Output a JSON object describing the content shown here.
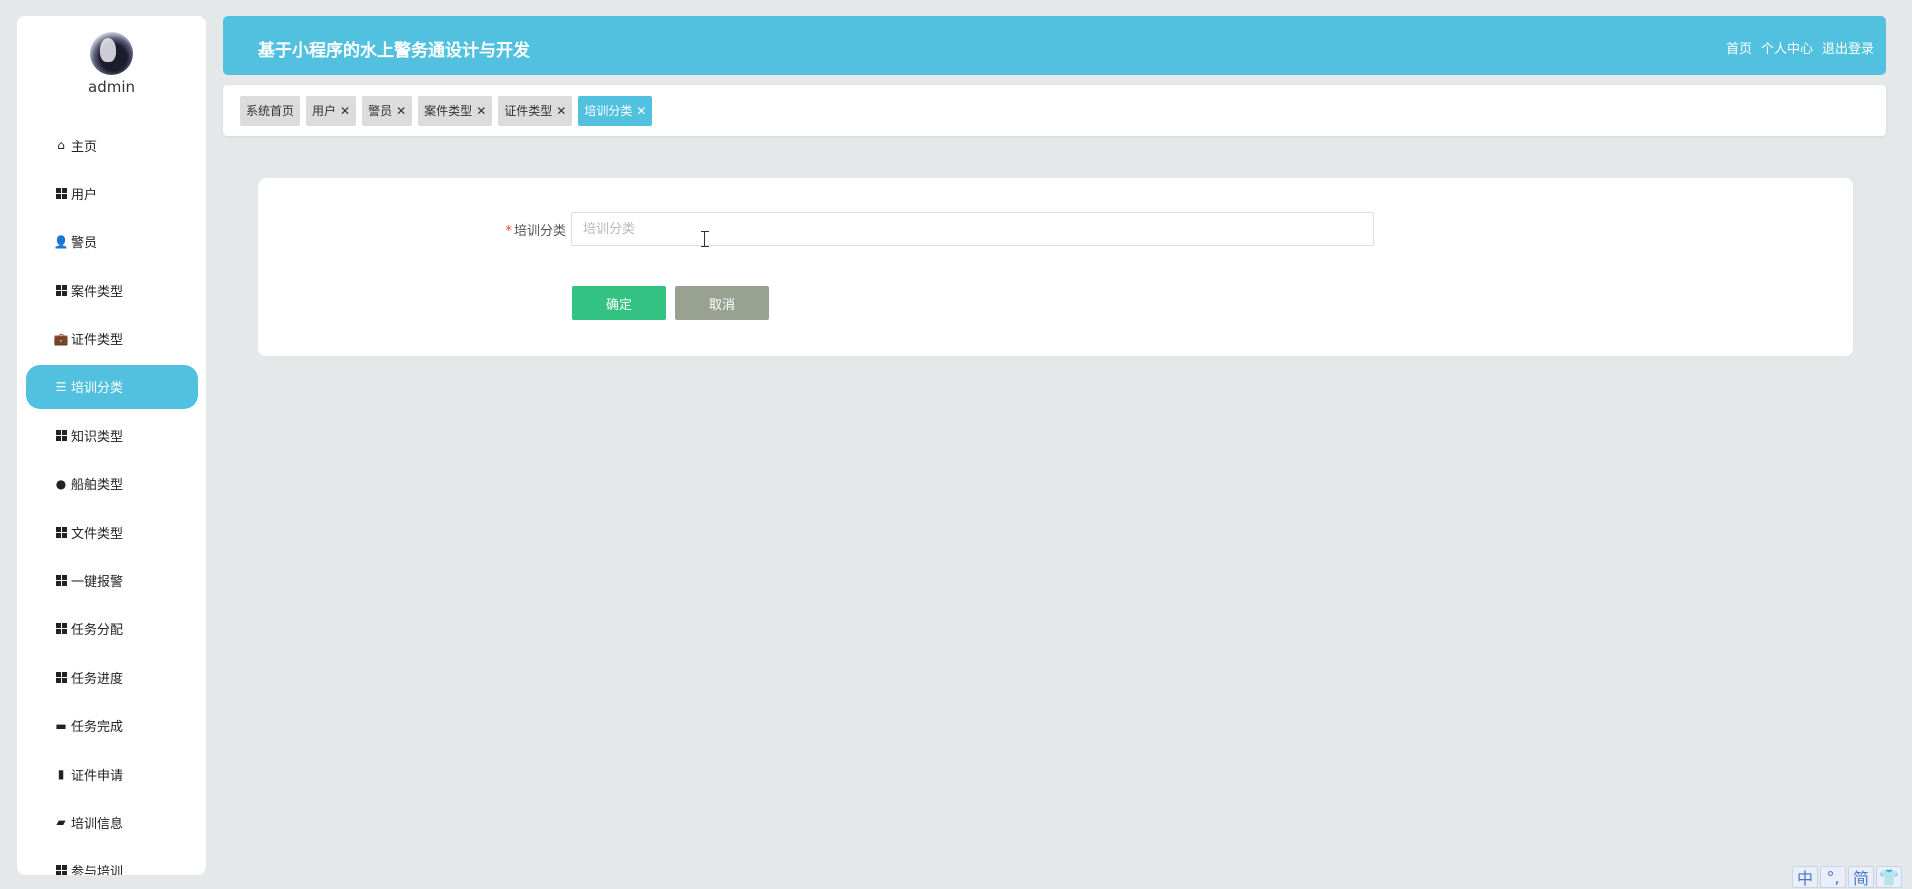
{
  "sidebar": {
    "username": "admin",
    "items": [
      {
        "label": "主页",
        "icon": "home-icon"
      },
      {
        "label": "用户",
        "icon": "grid-icon"
      },
      {
        "label": "警员",
        "icon": "person-icon"
      },
      {
        "label": "案件类型",
        "icon": "grid-icon"
      },
      {
        "label": "证件类型",
        "icon": "briefcase-icon"
      },
      {
        "label": "培训分类",
        "icon": "sliders-icon",
        "active": true
      },
      {
        "label": "知识类型",
        "icon": "grid-icon"
      },
      {
        "label": "船舶类型",
        "icon": "pin-icon"
      },
      {
        "label": "文件类型",
        "icon": "grid-icon"
      },
      {
        "label": "一键报警",
        "icon": "grid-icon"
      },
      {
        "label": "任务分配",
        "icon": "grid-icon"
      },
      {
        "label": "任务进度",
        "icon": "grid-icon"
      },
      {
        "label": "任务完成",
        "icon": "monitor-icon"
      },
      {
        "label": "证件申请",
        "icon": "clipboard-icon"
      },
      {
        "label": "培训信息",
        "icon": "wallet-icon"
      },
      {
        "label": "参与培训",
        "icon": "grid-icon"
      }
    ]
  },
  "header": {
    "title": "基于小程序的水上警务通设计与开发",
    "links": [
      "首页",
      "个人中心",
      "退出登录"
    ]
  },
  "tabs": [
    {
      "label": "系统首页",
      "closable": false
    },
    {
      "label": "用户",
      "closable": true
    },
    {
      "label": "警员",
      "closable": true
    },
    {
      "label": "案件类型",
      "closable": true
    },
    {
      "label": "证件类型",
      "closable": true
    },
    {
      "label": "培训分类",
      "closable": true,
      "active": true
    }
  ],
  "form": {
    "required_mark": "*",
    "label": "培训分类",
    "value": "",
    "placeholder": "培训分类",
    "confirm_label": "确定",
    "cancel_label": "取消"
  },
  "ime": [
    "中",
    "°,",
    "简",
    "👕"
  ],
  "colors": {
    "accent": "#52c1df",
    "confirm": "#33c281",
    "cancel": "#99a291",
    "background": "#e4e8e8"
  }
}
